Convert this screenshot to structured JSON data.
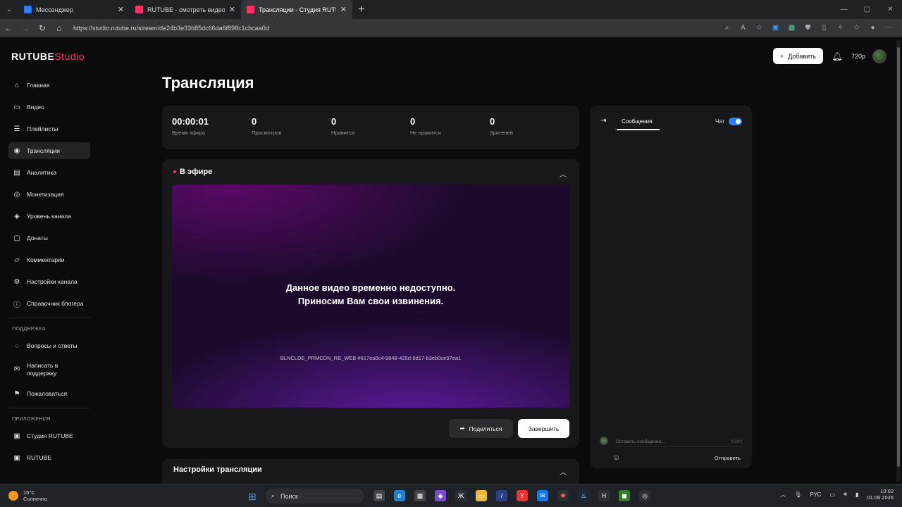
{
  "browser": {
    "tabs": [
      {
        "title": "Мессенджер",
        "color": "#2f7cf6",
        "active": false
      },
      {
        "title": "RUTUBE - смотреть видео онлайн",
        "color": "#ff3366",
        "active": false
      },
      {
        "title": "Трансляции - Студия RUTUBE",
        "color": "#ff3366",
        "active": true
      }
    ],
    "url": "https://studio.rutube.ru/stream/de24b3e33b85dc66da6f898c1cbcaa0d"
  },
  "header": {
    "logo_main": "RUTUBE",
    "logo_studio": "Studio",
    "add_label": "Добавить",
    "quality": "720p"
  },
  "sidebar": {
    "items": [
      {
        "label": "Главная",
        "icon": "home-icon",
        "glyph": "⌂"
      },
      {
        "label": "Видео",
        "icon": "video-icon",
        "glyph": "▭"
      },
      {
        "label": "Плейлисты",
        "icon": "playlist-icon",
        "glyph": "☰"
      },
      {
        "label": "Трансляции",
        "icon": "broadcast-icon",
        "glyph": "◉",
        "active": true
      },
      {
        "label": "Аналитика",
        "icon": "analytics-icon",
        "glyph": "▤"
      },
      {
        "label": "Монетизация",
        "icon": "money-icon",
        "glyph": "◎"
      },
      {
        "label": "Уровень канала",
        "icon": "level-icon",
        "glyph": "◈"
      },
      {
        "label": "Донаты",
        "icon": "donate-icon",
        "glyph": "▢"
      },
      {
        "label": "Комментарии",
        "icon": "comments-icon",
        "glyph": "▱"
      },
      {
        "label": "Настройки канала",
        "icon": "settings-icon",
        "glyph": "⚙"
      },
      {
        "label": "Справочник блогера",
        "icon": "info-icon",
        "glyph": "ⓘ"
      }
    ],
    "support_title": "ПОДДЕРЖКА",
    "support": [
      {
        "label": "Вопросы и ответы",
        "icon": "faq-icon",
        "glyph": "◌"
      },
      {
        "label": "Написать в поддержку",
        "icon": "mail-icon",
        "glyph": "✉"
      },
      {
        "label": "Пожаловаться",
        "icon": "flag-icon",
        "glyph": "⚑"
      }
    ],
    "apps_title": "ПРИЛОЖЕНИЯ",
    "apps": [
      {
        "label": "Студия RUTUBE",
        "icon": "studio-app-icon",
        "glyph": "▣"
      },
      {
        "label": "RUTUBE",
        "icon": "rutube-app-icon",
        "glyph": "▣"
      }
    ]
  },
  "main": {
    "title": "Трансляция",
    "stats": [
      {
        "value": "00:00:01",
        "label": "Время эфира"
      },
      {
        "value": "0",
        "label": "Просмотров"
      },
      {
        "value": "0",
        "label": "Нравится"
      },
      {
        "value": "0",
        "label": "Не нравится"
      },
      {
        "value": "0",
        "label": "Зрителей"
      }
    ],
    "live_label": "В эфире",
    "player_msg_1": "Данное видео временно недоступно.",
    "player_msg_2": "Приносим Вам свои извинения.",
    "player_code": "BLNCLDE_PRMCDN_RB_WEB #617ea0c4-9848-425d-8d17-b3eb0ce97ea1",
    "share_label": "Поделиться",
    "end_label": "Завершить",
    "settings_title": "Настройки трансляции"
  },
  "chat": {
    "tab_label": "Сообщения",
    "toggle_label": "Чат",
    "input_placeholder": "Оставить сообщение...",
    "counter": "0/200",
    "send_label": "Отправить"
  },
  "taskbar": {
    "temp": "15°C",
    "weather": "Солнечно",
    "search": "Поиск",
    "lang": "РУС",
    "time": "10:02",
    "date": "01.06.2026"
  }
}
